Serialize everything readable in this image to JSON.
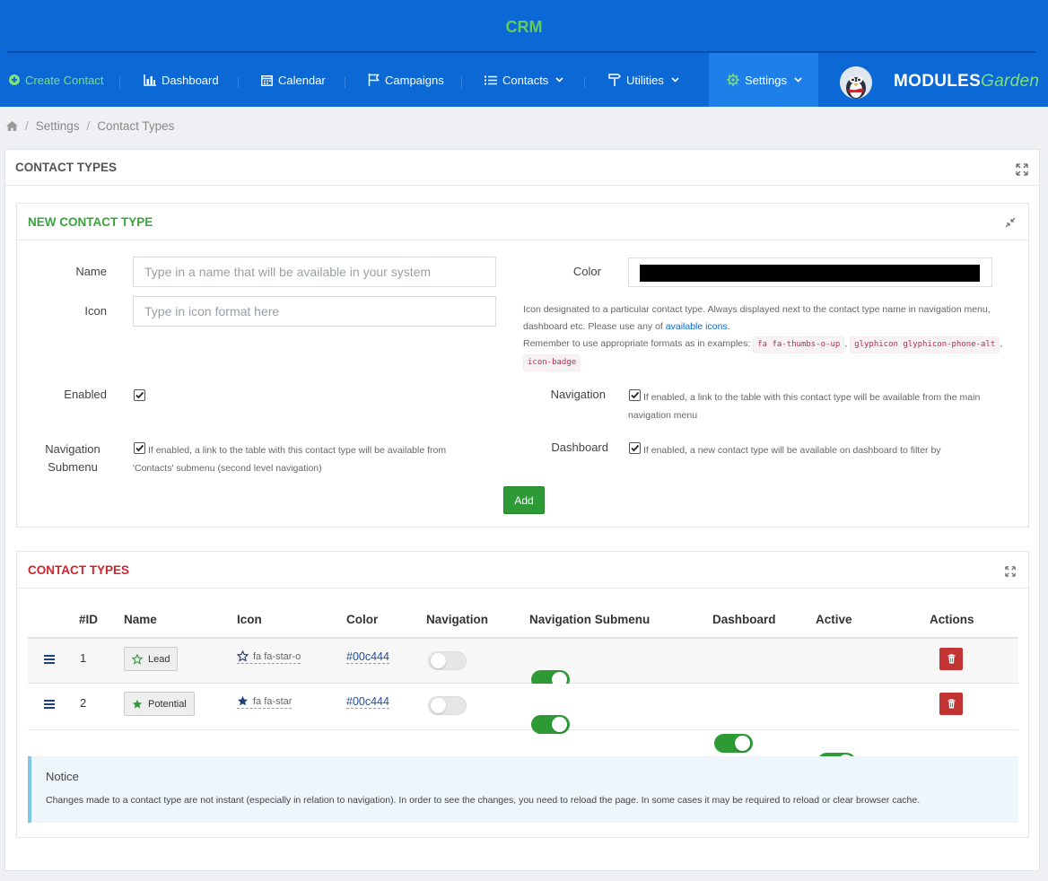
{
  "app": {
    "title": "CRM"
  },
  "colors": {
    "header_bg": "#0b68d4",
    "accent_green": "#2e9a36",
    "danger": "#c33332",
    "title_green": "#3aa33f",
    "title_red": "#d0232b"
  },
  "nav": {
    "create_contact": "Create Contact",
    "dashboard": "Dashboard",
    "calendar": "Calendar",
    "campaigns": "Campaigns",
    "contacts": "Contacts",
    "utilities": "Utilities",
    "settings": "Settings",
    "logo_main": "MODULES",
    "logo_sub": "Garden"
  },
  "breadcrumb": {
    "home_icon": "home-icon",
    "items": [
      "Settings",
      "Contact Types"
    ]
  },
  "outer_panel": {
    "title": "CONTACT TYPES"
  },
  "form": {
    "title": "NEW CONTACT TYPE",
    "name_label": "Name",
    "name_placeholder": "Type in a name that will be available in your system",
    "icon_label": "Icon",
    "icon_placeholder": "Type in icon format here",
    "color_label": "Color",
    "color_value": "#000000",
    "icon_help_1": "Icon designated to a particular contact type. Always displayed next to the contact type name in navigation menu, dashboard etc. Please use any of ",
    "icon_help_link": "available icons",
    "icon_help_2": "Remember to use appropriate formats as in examples: ",
    "icon_help_examples": [
      "fa fa-thumbs-o-up",
      "glyphicon glyphicon-phone-alt",
      "icon-badge"
    ],
    "enabled_label": "Enabled",
    "navigation_label": "Navigation",
    "navigation_help": "If enabled, a link to the table with this contact type will be available from the main navigation menu",
    "nav_submenu_label_1": "Navigation",
    "nav_submenu_label_2": "Submenu",
    "nav_submenu_help": "If enabled, a link to the table with this contact type will be available from 'Contacts' submenu (second level navigation)",
    "dashboard_label": "Dashboard",
    "dashboard_help": "If enabled, a new contact type will be available on dashboard to filter by",
    "add_button": "Add"
  },
  "table": {
    "title": "CONTACT TYPES",
    "columns": [
      "#ID",
      "Name",
      "Icon",
      "Color",
      "Navigation",
      "Navigation Submenu",
      "Dashboard",
      "Active",
      "Actions"
    ],
    "rows": [
      {
        "id": "1",
        "name": "Lead",
        "icon": "fa fa-star-o",
        "color": "#00c444",
        "navigation": false,
        "submenu": true,
        "dashboard": true,
        "active": true
      },
      {
        "id": "2",
        "name": "Potential",
        "icon": "fa fa-star",
        "color": "#00c444",
        "navigation": false,
        "submenu": true,
        "dashboard": true,
        "active": true
      }
    ]
  },
  "notice": {
    "title": "Notice",
    "text": "Changes made to a contact type are not instant (especially in relation to navigation). In order to see the changes, you need to reload the page. In some cases it may be required to reload or clear browser cache."
  }
}
